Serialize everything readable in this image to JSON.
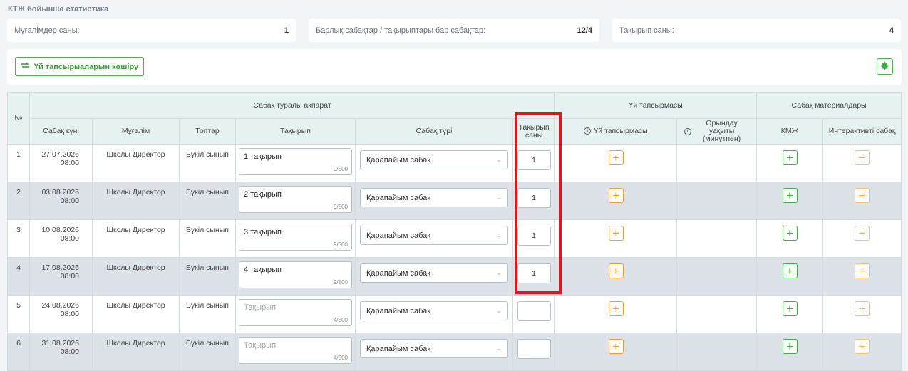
{
  "section_title": "КТЖ бойынша статистика",
  "stats": [
    {
      "label": "Мұғалімдер саны:",
      "value": "1"
    },
    {
      "label": "Барлық сабақтар / тақырыптары бар сабақтар:",
      "value": "12/4"
    },
    {
      "label": "Тақырып саны:",
      "value": "4"
    }
  ],
  "toolbar": {
    "copy_label": "Үй тапсырмаларын көшіру",
    "copy_icon": "swap-arrows-icon",
    "settings_icon": "gear-icon"
  },
  "table": {
    "groups": {
      "number": "№",
      "lesson_info": "Сабақ туралы ақпарат",
      "homework": "Үй тапсырмасы",
      "materials": "Сабақ материалдары"
    },
    "columns": {
      "date": "Сабақ күні",
      "teacher": "Мұғалім",
      "group": "Топтар",
      "topic": "Тақырып",
      "lesson_type": "Сабақ түрі",
      "topic_count": "Тақырып саны",
      "homework": "Үй тапсырмасы",
      "duration": "Орындау уақыты (минутпен)",
      "kmzh": "ҚМЖ",
      "interactive": "Интерактивті сабақ"
    },
    "topic_placeholder": "Тақырып",
    "rows": [
      {
        "n": "1",
        "date": "27.07.2026",
        "time": "08:00",
        "teacher": "Школы Директор",
        "group": "Бүкіл сынып",
        "topic": "1 тақырып",
        "counter": "9/500",
        "type": "Қарапайым сабақ",
        "count": "1"
      },
      {
        "n": "2",
        "date": "03.08.2026",
        "time": "08:00",
        "teacher": "Школы Директор",
        "group": "Бүкіл сынып",
        "topic": "2 тақырып",
        "counter": "9/500",
        "type": "Қарапайым сабақ",
        "count": "1"
      },
      {
        "n": "3",
        "date": "10.08.2026",
        "time": "08:00",
        "teacher": "Школы Директор",
        "group": "Бүкіл сынып",
        "topic": "3 тақырып",
        "counter": "9/500",
        "type": "Қарапайым сабақ",
        "count": "1"
      },
      {
        "n": "4",
        "date": "17.08.2026",
        "time": "08:00",
        "teacher": "Школы Директор",
        "group": "Бүкіл сынып",
        "topic": "4 тақырып",
        "counter": "9/500",
        "type": "Қарапайым сабақ",
        "count": "1"
      },
      {
        "n": "5",
        "date": "24.08.2026",
        "time": "08:00",
        "teacher": "Школы Директор",
        "group": "Бүкіл сынып",
        "topic": "",
        "counter": "4/500",
        "type": "Қарапайым сабақ",
        "count": ""
      },
      {
        "n": "6",
        "date": "31.08.2026",
        "time": "08:00",
        "teacher": "Школы Директор",
        "group": "Бүкіл сынып",
        "topic": "",
        "counter": "4/500",
        "type": "Қарапайым сабақ",
        "count": ""
      }
    ]
  },
  "colors": {
    "accent_green": "#3ea84a",
    "accent_orange": "#f0a02a",
    "highlight_red": "#e0161b",
    "header_bg": "#e6f1f1"
  }
}
